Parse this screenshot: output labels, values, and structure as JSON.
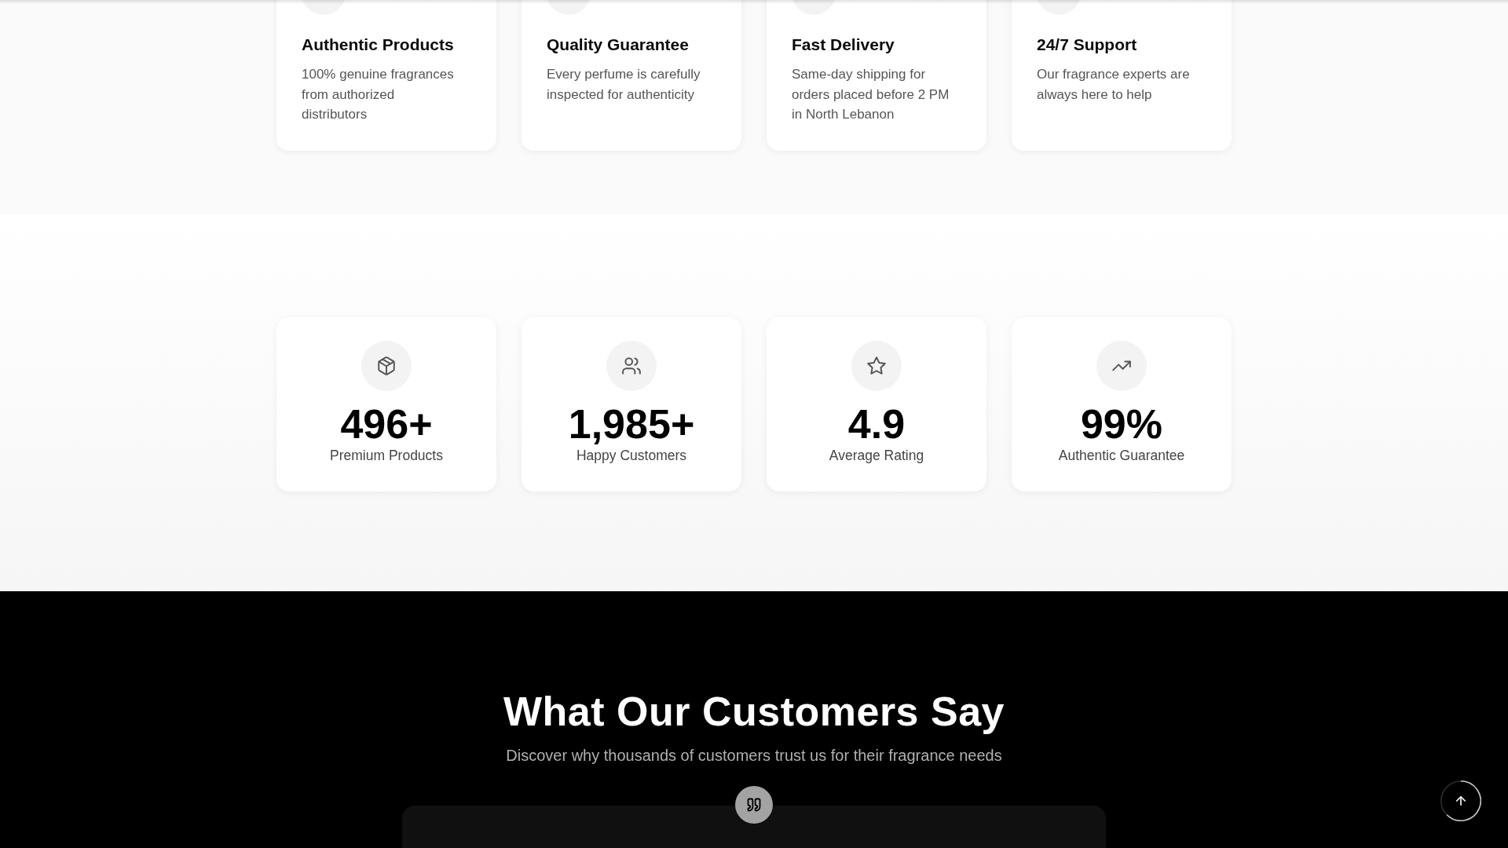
{
  "features": [
    {
      "title": "Authentic Products",
      "description": "100% genuine fragrances from authorized distributors"
    },
    {
      "title": "Quality Guarantee",
      "description": "Every perfume is carefully inspected for authenticity"
    },
    {
      "title": "Fast Delivery",
      "description": "Same-day shipping for orders placed before 2 PM in North Lebanon"
    },
    {
      "title": "24/7 Support",
      "description": "Our fragrance experts are always here to help"
    }
  ],
  "stats": [
    {
      "value": "496+",
      "label": "Premium Products"
    },
    {
      "value": "1,985+",
      "label": "Happy Customers"
    },
    {
      "value": "4.9",
      "label": "Average Rating"
    },
    {
      "value": "99%",
      "label": "Authentic Guarantee"
    }
  ],
  "testimonials": {
    "title": "What Our Customers Say",
    "subtitle": "Discover why thousands of customers trust us for their fragrance needs"
  }
}
